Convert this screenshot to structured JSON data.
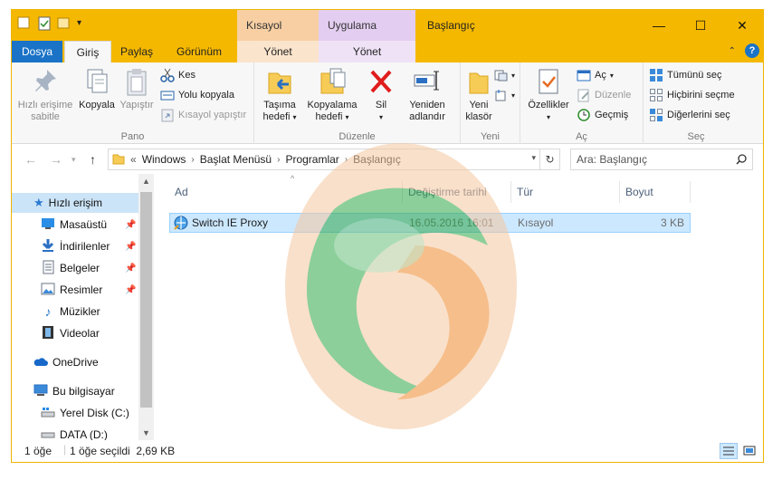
{
  "titlebar": {
    "context_tabs": [
      "Kısayol Araçları",
      "Uygulama Araçları"
    ],
    "title": "Başlangıç",
    "minimize": "—",
    "maximize": "☐",
    "close": "✕"
  },
  "tabs": {
    "file": "Dosya",
    "home": "Giriş",
    "share": "Paylaş",
    "view": "Görünüm",
    "manage1": "Yönet",
    "manage2": "Yönet"
  },
  "ribbon": {
    "clipboard": {
      "label": "Pano",
      "pin": "Hızlı erişime sabitle",
      "copy": "Kopyala",
      "paste": "Yapıştır",
      "cut": "Kes",
      "copy_path": "Yolu kopyala",
      "paste_shortcut": "Kısayol yapıştır"
    },
    "organize": {
      "label": "Düzenle",
      "move_to": "Taşıma hedefi",
      "copy_to": "Kopyalama hedefi",
      "delete": "Sil",
      "rename": "Yeniden adlandır"
    },
    "new": {
      "label": "Yeni",
      "new_folder": "Yeni klasör"
    },
    "open": {
      "label": "Aç",
      "properties": "Özellikler",
      "open": "Aç",
      "edit": "Düzenle",
      "history": "Geçmiş"
    },
    "select": {
      "label": "Seç",
      "select_all": "Tümünü seç",
      "select_none": "Hiçbirini seçme",
      "invert": "Diğerlerini seç"
    }
  },
  "address": {
    "prefix": "«",
    "crumbs": [
      "Windows",
      "Başlat Menüsü",
      "Programlar",
      "Başlangıç"
    ],
    "search_placeholder": "Ara: Başlangıç"
  },
  "nav": [
    {
      "label": "Hızlı erişim",
      "icon": "star-icon"
    },
    {
      "label": "Masaüstü",
      "icon": "desktop-icon"
    },
    {
      "label": "İndirilenler",
      "icon": "download-icon"
    },
    {
      "label": "Belgeler",
      "icon": "documents-icon"
    },
    {
      "label": "Resimler",
      "icon": "pictures-icon"
    },
    {
      "label": "Müzikler",
      "icon": "music-icon"
    },
    {
      "label": "Videolar",
      "icon": "video-icon"
    },
    {
      "label": "OneDrive",
      "icon": "cloud-icon"
    },
    {
      "label": "Bu bilgisayar",
      "icon": "computer-icon"
    },
    {
      "label": "Yerel Disk (C:)",
      "icon": "disk-icon"
    },
    {
      "label": "DATA (D:)",
      "icon": "disk-icon"
    }
  ],
  "columns": [
    "Ad",
    "Değiştirme tarihi",
    "Tür",
    "Boyut"
  ],
  "files": [
    {
      "name": "Switch IE Proxy",
      "date": "16.05.2016 16:01",
      "type": "Kısayol",
      "size": "3 KB"
    }
  ],
  "status": {
    "count": "1 öğe",
    "selected": "1 öğe seçildi  2,69 KB"
  },
  "colors": {
    "accent": "#f5b800",
    "file_tab": "#1a73c6",
    "selection": "#cce8ff"
  }
}
